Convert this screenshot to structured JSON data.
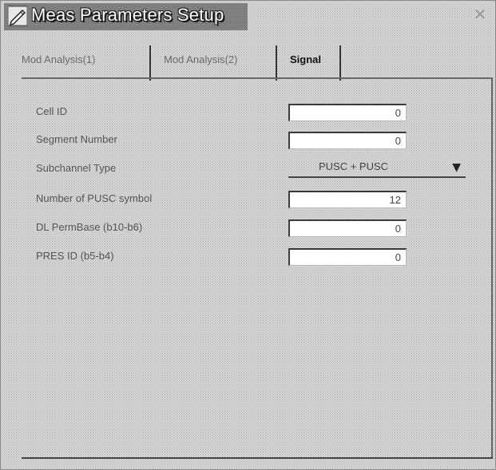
{
  "window": {
    "title": "Meas Parameters Setup",
    "close_glyph": "✕"
  },
  "tabs": [
    {
      "label": "Mod Analysis(1)",
      "active": false
    },
    {
      "label": "Mod Analysis(2)",
      "active": false
    },
    {
      "label": "Signal",
      "active": true
    }
  ],
  "fields": {
    "cell_id": {
      "label": "Cell ID",
      "value": "0"
    },
    "segment_number": {
      "label": "Segment Number",
      "value": "0"
    },
    "subchannel_type": {
      "label": "Subchannel Type",
      "value": "PUSC + PUSC"
    },
    "pusc_symbols": {
      "label": "Number of PUSC symbol",
      "value": "12"
    },
    "dl_permbase": {
      "label": "DL PermBase (b10-b6)",
      "value": "0"
    },
    "pres_id": {
      "label": "PRES ID (b5-b4)",
      "value": "0"
    }
  },
  "icons": {
    "app": "pencil-icon",
    "close": "close-icon",
    "dropdown": "chevron-down-icon"
  }
}
